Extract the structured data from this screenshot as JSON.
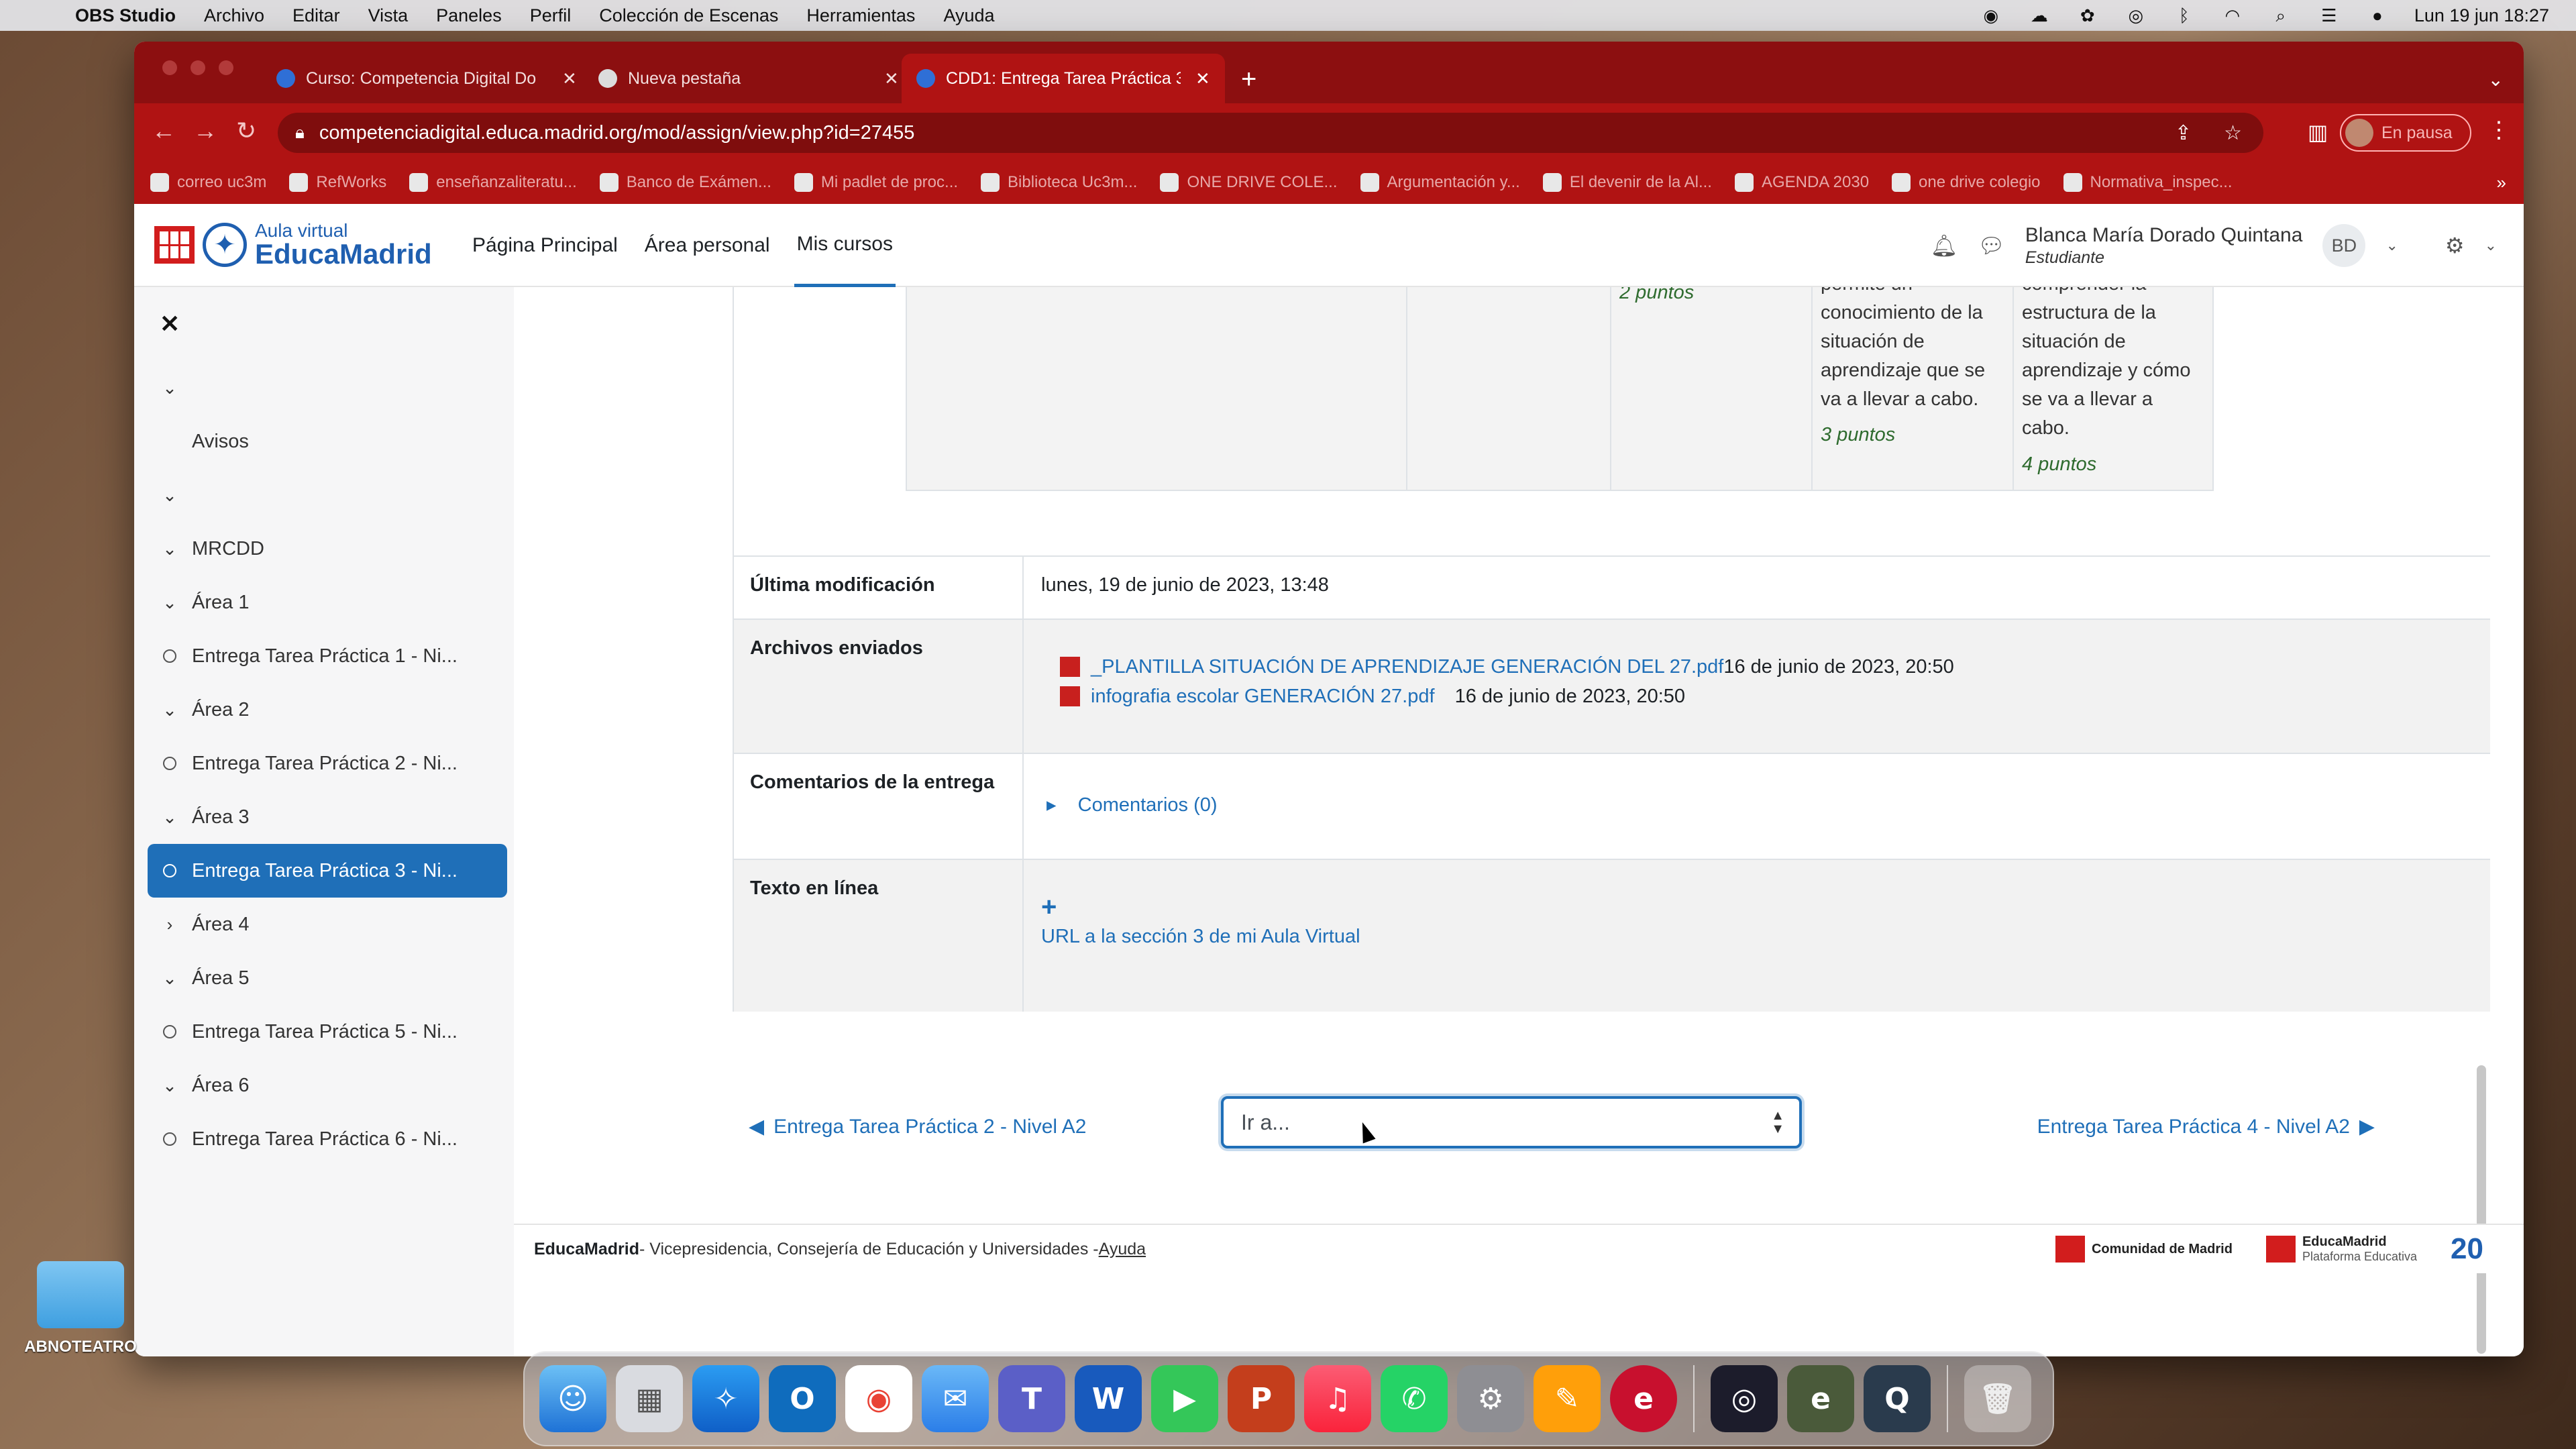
{
  "menubar": {
    "app_name": "OBS Studio",
    "items": [
      "Archivo",
      "Editar",
      "Vista",
      "Paneles",
      "Perfil",
      "Colección de Escenas",
      "Herramientas",
      "Ayuda"
    ],
    "clock": "Lun 19 jun 18:27"
  },
  "browser": {
    "tabs": [
      {
        "title": "Curso: Competencia Digital Do",
        "icon": "moodle-cap-icon"
      },
      {
        "title": "Nueva pestaña",
        "icon": "chrome-icon"
      },
      {
        "title": "CDD1: Entrega Tarea Práctica 3",
        "icon": "moodle-cap-icon"
      }
    ],
    "url": "competenciadigital.educa.madrid.org/mod/assign/view.php?id=27455",
    "profile_label": "En pausa",
    "bookmarks": [
      "correo uc3m",
      "RefWorks",
      "enseñanzaliteratu...",
      "Banco de Exámen...",
      "Mi padlet de proc...",
      "Biblioteca Uc3m...",
      "ONE DRIVE COLE...",
      "Argumentación y...",
      "El devenir de la Al...",
      "AGENDA 2030",
      "one drive colegio",
      "Normativa_inspec..."
    ]
  },
  "site": {
    "logo_line1": "Aula virtual",
    "logo_line2": "EducaMadrid",
    "nav": [
      "Página Principal",
      "Área personal",
      "Mis cursos"
    ],
    "user_name": "Blanca María Dorado Quintana",
    "user_role": "Estudiante",
    "user_initials": "BD"
  },
  "drawer": {
    "items": [
      {
        "type": "chevron",
        "text": ""
      },
      {
        "type": "plain",
        "text": "Avisos"
      },
      {
        "type": "chevron",
        "text": ""
      },
      {
        "type": "chevron",
        "text": "MRCDD"
      },
      {
        "type": "chevron",
        "text": "Área 1"
      },
      {
        "type": "circle",
        "text": "Entrega Tarea Práctica 1 - Ni..."
      },
      {
        "type": "chevron",
        "text": "Área 2"
      },
      {
        "type": "circle",
        "text": "Entrega Tarea Práctica 2 - Ni..."
      },
      {
        "type": "chevron",
        "text": "Área 3"
      },
      {
        "type": "circle",
        "text": "Entrega Tarea Práctica 3 - Ni...",
        "active": true
      },
      {
        "type": "chevron-right",
        "text": "Área 4"
      },
      {
        "type": "chevron",
        "text": "Área 5"
      },
      {
        "type": "circle",
        "text": "Entrega Tarea Práctica 5 - Ni..."
      },
      {
        "type": "chevron",
        "text": "Área 6"
      },
      {
        "type": "circle",
        "text": "Entrega Tarea Práctica 6 - Ni..."
      }
    ]
  },
  "rubric": {
    "col1_points": "2 puntos",
    "col2_text": [
      "permite un",
      "conocimiento de la",
      "situación de",
      "aprendizaje que se",
      "va a llevar a cabo."
    ],
    "col2_points": "3 puntos",
    "col3_text": [
      "comprender la",
      "estructura de la",
      "situación de",
      "aprendizaje y cómo",
      "se va a llevar a",
      "cabo."
    ],
    "col3_points": "4 puntos"
  },
  "submission": {
    "last_modified_label": "Última modificación",
    "last_modified_value": "lunes, 19 de junio de 2023, 13:48",
    "files_label": "Archivos enviados",
    "files": [
      {
        "name": "_PLANTILLA SITUACIÓN DE APRENDIZAJE GENERACIÓN DEL 27.pdf",
        "date": "16 de junio de 2023, 20:50"
      },
      {
        "name": "infografia escolar GENERACIÓN 27.pdf",
        "date": "16 de junio de 2023, 20:50"
      }
    ],
    "comments_label": "Comentarios de la entrega",
    "comments_link": "Comentarios (0)",
    "online_text_label": "Texto en línea",
    "online_text_link": "URL a la sección 3 de mi Aula Virtual"
  },
  "navigation": {
    "prev": "Entrega Tarea Práctica 2 - Nivel A2",
    "next": "Entrega Tarea Práctica 4 - Nivel A2",
    "jump_placeholder": "Ir a..."
  },
  "footer": {
    "brand": "EducaMadrid",
    "text": " - Vicepresidencia, Consejería de Educación y Universidades - ",
    "help": "Ayuda",
    "logo1": "Comunidad de Madrid",
    "logo2": "EducaMadrid",
    "logo2_sub": "Plataforma Educativa"
  },
  "desktop": {
    "folder_label": "ABNOTEATRO"
  },
  "dock_apps": [
    "finder",
    "launchpad",
    "safari",
    "outlook",
    "chrome",
    "mail",
    "teams",
    "word",
    "facetime",
    "powerpoint",
    "music",
    "whatsapp",
    "system-settings",
    "pages",
    "educamadrid",
    "obs",
    "exelearning",
    "quicktime",
    "trash"
  ]
}
